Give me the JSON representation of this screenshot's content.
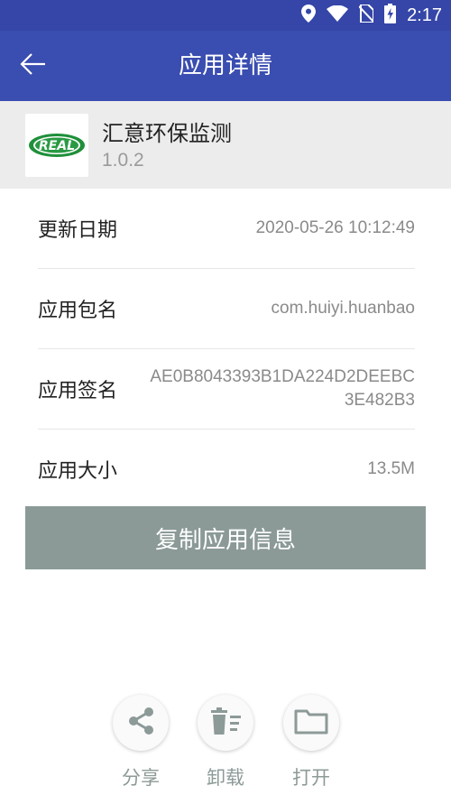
{
  "status_bar": {
    "time": "2:17",
    "icons": [
      "location-icon",
      "wifi-icon",
      "no-sim-icon",
      "battery-charging-icon"
    ]
  },
  "app_bar": {
    "title": "应用详情",
    "back_icon": "arrow-left-icon"
  },
  "app": {
    "name": "汇意环保监测",
    "version": "1.0.2",
    "icon_text": "REAL"
  },
  "details": [
    {
      "label": "更新日期",
      "value": "2020-05-26 10:12:49"
    },
    {
      "label": "应用包名",
      "value": "com.huiyi.huanbao"
    },
    {
      "label": "应用签名",
      "value": "AE0B8043393B1DA224D2DEEBC3E482B3"
    },
    {
      "label": "应用大小",
      "value": "13.5M"
    }
  ],
  "copy_button": "复制应用信息",
  "actions": [
    {
      "label": "分享",
      "icon": "share-icon"
    },
    {
      "label": "卸载",
      "icon": "trash-icon"
    },
    {
      "label": "打开",
      "icon": "folder-icon"
    }
  ],
  "colors": {
    "app_bar": "#3a4db0",
    "status_bar": "#3546a8",
    "copy_button": "#8b9a97",
    "action_label": "#8c9a98"
  }
}
